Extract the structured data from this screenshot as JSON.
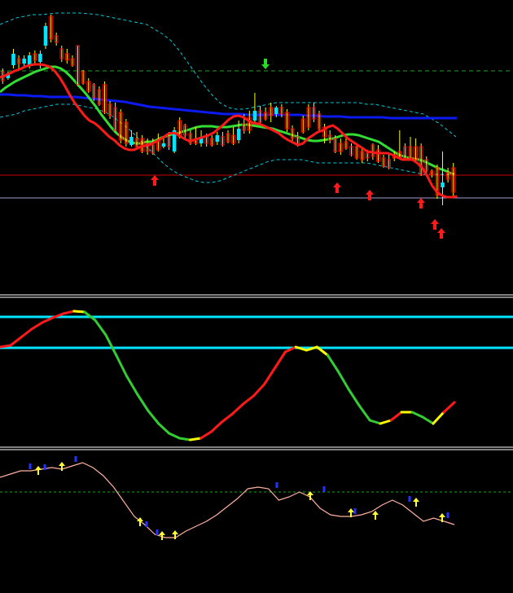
{
  "colors": {
    "background": "#000000",
    "bull_candle": "#00E5FF",
    "bear_candle": "#FF0000",
    "wick": "#FFFF00",
    "ma_fast": "#FF1A1A",
    "ma_mid": "#33DD33",
    "ma_slow": "#0A1AF0",
    "bands": "#00C8D8",
    "panel_sep": "#FFFFFF",
    "level_line": "#00E5FF",
    "osc_up": "#33CC33",
    "osc_down": "#FF1A1A",
    "osc_turn": "#FFFF00",
    "arrow_up": "#FF1A1A",
    "arrow_down": "#22DD22",
    "hline_red": "#CC0000",
    "hline_grey": "#9AA0C8",
    "hline_green_dash": "#1FA01F",
    "lower_line": "#FFB0A0",
    "lower_dash": "#1FA01F",
    "lower_up_arrow": "#FFFF33",
    "lower_down_mark": "#2233FF"
  },
  "chart_data": [
    {
      "type": "line",
      "panel": "price",
      "candles": [
        {
          "o": 88,
          "c": 99,
          "h": 84,
          "l": 103
        },
        {
          "o": 96,
          "c": 90,
          "h": 88,
          "l": 98
        },
        {
          "o": 80,
          "c": 66,
          "h": 60,
          "l": 84
        },
        {
          "o": 72,
          "c": 78,
          "h": 68,
          "l": 84
        },
        {
          "o": 78,
          "c": 72,
          "h": 68,
          "l": 82
        },
        {
          "o": 80,
          "c": 68,
          "h": 64,
          "l": 84
        },
        {
          "o": 66,
          "c": 74,
          "h": 62,
          "l": 80
        },
        {
          "o": 76,
          "c": 66,
          "h": 62,
          "l": 84
        },
        {
          "o": 56,
          "c": 32,
          "h": 28,
          "l": 60
        },
        {
          "o": 20,
          "c": 48,
          "h": 18,
          "l": 52
        },
        {
          "o": 44,
          "c": 52,
          "h": 40,
          "l": 56
        },
        {
          "o": 60,
          "c": 72,
          "h": 56,
          "l": 76
        },
        {
          "o": 66,
          "c": 74,
          "h": 60,
          "l": 78
        },
        {
          "o": 72,
          "c": 80,
          "h": 68,
          "l": 82
        },
        {
          "o": 56,
          "c": 104,
          "h": 56,
          "l": 106
        },
        {
          "o": 88,
          "c": 102,
          "h": 86,
          "l": 104
        },
        {
          "o": 100,
          "c": 112,
          "h": 96,
          "l": 114
        },
        {
          "o": 104,
          "c": 120,
          "h": 102,
          "l": 124
        },
        {
          "o": 110,
          "c": 128,
          "h": 106,
          "l": 130
        },
        {
          "o": 104,
          "c": 138,
          "h": 100,
          "l": 140
        },
        {
          "o": 128,
          "c": 142,
          "h": 124,
          "l": 146
        },
        {
          "o": 132,
          "c": 160,
          "h": 126,
          "l": 162
        },
        {
          "o": 138,
          "c": 172,
          "h": 134,
          "l": 176
        },
        {
          "o": 150,
          "c": 176,
          "h": 146,
          "l": 180
        },
        {
          "o": 178,
          "c": 168,
          "h": 160,
          "l": 180
        },
        {
          "o": 170,
          "c": 180,
          "h": 162,
          "l": 184
        },
        {
          "o": 170,
          "c": 186,
          "h": 166,
          "l": 188
        },
        {
          "o": 176,
          "c": 186,
          "h": 170,
          "l": 190
        },
        {
          "o": 178,
          "c": 188,
          "h": 170,
          "l": 190
        },
        {
          "o": 172,
          "c": 184,
          "h": 164,
          "l": 186
        },
        {
          "o": 180,
          "c": 176,
          "h": 168,
          "l": 182
        },
        {
          "o": 168,
          "c": 180,
          "h": 162,
          "l": 184
        },
        {
          "o": 186,
          "c": 160,
          "h": 156,
          "l": 188
        },
        {
          "o": 148,
          "c": 168,
          "h": 144,
          "l": 170
        },
        {
          "o": 154,
          "c": 166,
          "h": 152,
          "l": 170
        },
        {
          "o": 164,
          "c": 176,
          "h": 160,
          "l": 178
        },
        {
          "o": 170,
          "c": 176,
          "h": 156,
          "l": 178
        },
        {
          "o": 176,
          "c": 168,
          "h": 160,
          "l": 180
        },
        {
          "o": 168,
          "c": 176,
          "h": 164,
          "l": 180
        },
        {
          "o": 170,
          "c": 178,
          "h": 166,
          "l": 180
        },
        {
          "o": 174,
          "c": 166,
          "h": 162,
          "l": 178
        },
        {
          "o": 168,
          "c": 178,
          "h": 162,
          "l": 180
        },
        {
          "o": 164,
          "c": 174,
          "h": 160,
          "l": 176
        },
        {
          "o": 166,
          "c": 176,
          "h": 156,
          "l": 178
        },
        {
          "o": 172,
          "c": 158,
          "h": 148,
          "l": 176
        },
        {
          "o": 152,
          "c": 160,
          "h": 140,
          "l": 164
        },
        {
          "o": 144,
          "c": 160,
          "h": 136,
          "l": 164
        },
        {
          "o": 148,
          "c": 136,
          "h": 114,
          "l": 152
        },
        {
          "o": 136,
          "c": 150,
          "h": 130,
          "l": 154
        },
        {
          "o": 138,
          "c": 146,
          "h": 132,
          "l": 148
        },
        {
          "o": 132,
          "c": 142,
          "h": 126,
          "l": 150
        },
        {
          "o": 140,
          "c": 132,
          "h": 130,
          "l": 144
        },
        {
          "o": 132,
          "c": 140,
          "h": 128,
          "l": 144
        },
        {
          "o": 138,
          "c": 158,
          "h": 134,
          "l": 162
        },
        {
          "o": 158,
          "c": 170,
          "h": 154,
          "l": 176
        },
        {
          "o": 168,
          "c": 178,
          "h": 162,
          "l": 180
        },
        {
          "o": 146,
          "c": 162,
          "h": 142,
          "l": 164
        },
        {
          "o": 132,
          "c": 156,
          "h": 128,
          "l": 160
        },
        {
          "o": 132,
          "c": 146,
          "h": 126,
          "l": 150
        },
        {
          "o": 140,
          "c": 158,
          "h": 136,
          "l": 160
        },
        {
          "o": 156,
          "c": 168,
          "h": 152,
          "l": 176
        },
        {
          "o": 166,
          "c": 172,
          "h": 160,
          "l": 176
        },
        {
          "o": 170,
          "c": 186,
          "h": 166,
          "l": 188
        },
        {
          "o": 176,
          "c": 186,
          "h": 170,
          "l": 190
        },
        {
          "o": 174,
          "c": 182,
          "h": 170,
          "l": 184
        },
        {
          "o": 180,
          "c": 190,
          "h": 176,
          "l": 192
        },
        {
          "o": 180,
          "c": 194,
          "h": 176,
          "l": 196
        },
        {
          "o": 186,
          "c": 196,
          "h": 182,
          "l": 200
        },
        {
          "o": 188,
          "c": 194,
          "h": 184,
          "l": 198
        },
        {
          "o": 178,
          "c": 192,
          "h": 176,
          "l": 196
        },
        {
          "o": 184,
          "c": 198,
          "h": 178,
          "l": 200
        },
        {
          "o": 194,
          "c": 204,
          "h": 190,
          "l": 206
        },
        {
          "o": 196,
          "c": 206,
          "h": 190,
          "l": 208
        },
        {
          "o": 190,
          "c": 194,
          "h": 186,
          "l": 198
        },
        {
          "o": 186,
          "c": 194,
          "h": 160,
          "l": 196
        },
        {
          "o": 180,
          "c": 194,
          "h": 176,
          "l": 196
        },
        {
          "o": 180,
          "c": 194,
          "h": 168,
          "l": 196
        },
        {
          "o": 180,
          "c": 196,
          "h": 170,
          "l": 198
        },
        {
          "o": 180,
          "c": 214,
          "h": 176,
          "l": 216
        },
        {
          "o": 196,
          "c": 210,
          "h": 192,
          "l": 214
        },
        {
          "o": 210,
          "c": 214,
          "h": 208,
          "l": 218
        },
        {
          "o": 206,
          "c": 240,
          "h": 202,
          "l": 244
        },
        {
          "o": 230,
          "c": 224,
          "h": 186,
          "l": 252
        },
        {
          "o": 212,
          "c": 220,
          "h": 206,
          "l": 224
        },
        {
          "o": 206,
          "c": 236,
          "h": 200,
          "l": 242
        }
      ],
      "series": [
        {
          "name": "",
          "values": [
            95,
            93,
            90,
            87,
            85,
            82,
            80,
            79,
            79,
            80,
            82,
            87,
            95,
            105,
            116,
            126,
            134,
            142,
            148,
            151,
            156,
            162,
            168,
            172,
            178,
            182,
            184,
            184,
            181,
            179,
            178,
            175,
            172,
            168,
            164,
            163,
            166,
            170,
            173,
            172,
            170,
            168,
            166,
            163,
            158,
            153,
            147,
            143,
            142,
            144,
            148,
            151,
            152,
            154,
            157,
            160,
            163,
            168,
            172,
            175,
            178,
            176,
            170,
            166,
            162,
            160,
            156,
            154,
            158,
            164,
            170,
            174,
            178,
            182,
            186,
            187,
            188,
            188,
            188,
            190,
            193,
            196,
            196,
            196,
            200,
            206,
            216,
            228,
            236,
            240,
            242,
            242,
            241
          ]
        },
        {
          "name": "",
          "values": [
            113,
            108,
            104,
            100,
            97,
            94,
            91,
            88,
            86,
            84,
            82,
            82,
            84,
            88,
            94,
            101,
            108,
            115,
            123,
            131,
            140,
            148,
            156,
            163,
            168,
            172,
            175,
            176,
            176,
            174,
            174,
            172,
            169,
            167,
            165,
            164,
            162,
            160,
            158,
            156,
            155,
            155,
            155,
            156,
            156,
            156,
            155,
            154,
            153,
            153,
            154,
            155,
            156,
            157,
            158,
            160,
            162,
            164,
            166,
            168,
            170,
            172,
            173,
            173,
            172,
            171,
            170,
            168,
            166,
            165,
            165,
            166,
            168,
            170,
            172,
            174,
            178,
            182,
            186,
            190,
            192,
            194,
            195,
            196,
            198,
            201,
            204,
            207,
            209,
            212,
            214
          ]
        },
        {
          "name": "",
          "values": [
            116,
            116,
            117,
            117,
            118,
            118,
            119,
            119,
            119,
            119,
            120,
            121,
            122,
            123,
            124,
            125,
            127,
            129,
            131,
            132,
            133,
            134,
            135,
            136,
            137,
            138,
            139,
            140,
            140,
            140,
            141,
            141,
            141,
            141,
            141,
            141,
            141,
            142,
            142,
            143,
            143,
            143,
            144,
            144,
            144,
            144,
            144,
            145,
            145,
            145,
            145,
            145,
            145,
            145,
            145,
            145
          ]
        }
      ],
      "bands": {
        "upper": [
          30,
          26,
          22,
          20,
          18,
          18,
          17,
          16,
          16,
          16,
          16,
          17,
          18,
          20,
          22,
          24,
          26,
          28,
          30,
          36,
          42,
          50,
          62,
          76,
          90,
          104,
          116,
          126,
          132,
          134,
          134,
          132,
          130,
          128,
          126,
          126,
          126,
          126,
          126,
          126,
          126,
          126,
          126,
          126,
          126,
          128,
          128,
          130,
          132,
          134,
          136,
          138,
          140,
          146,
          152,
          160,
          168
        ],
        "lower": [
          144,
          142,
          140,
          136,
          134,
          132,
          130,
          128,
          128,
          128,
          130,
          132,
          134,
          138,
          144,
          152,
          160,
          170,
          180,
          190,
          200,
          208,
          214,
          218,
          222,
          224,
          224,
          222,
          218,
          214,
          210,
          206,
          202,
          198,
          196,
          196,
          196,
          196,
          198,
          200,
          200,
          200,
          200,
          200,
          200,
          200,
          202,
          204,
          206,
          208,
          210,
          212,
          214,
          214,
          214,
          214,
          214
        ]
      },
      "hlines": [
        87,
        215,
        243
      ],
      "arrows_up": [
        [
          190,
          222
        ],
        [
          414,
          231
        ],
        [
          454,
          240
        ],
        [
          517,
          250
        ],
        [
          534,
          276
        ],
        [
          542,
          287
        ]
      ],
      "arrows_down": [
        [
          326,
          78
        ]
      ]
    },
    {
      "type": "line",
      "panel": "oscillator",
      "levels": [
        389,
        427
      ],
      "values": [
        426,
        424,
        414,
        404,
        396,
        390,
        385,
        382,
        383,
        393,
        411,
        436,
        462,
        484,
        504,
        520,
        532,
        538,
        540,
        538,
        530,
        518,
        508,
        496,
        486,
        472,
        452,
        432,
        426,
        430,
        426,
        436,
        456,
        478,
        498,
        516,
        520,
        516,
        506,
        506,
        512,
        520,
        506,
        494
      ]
    },
    {
      "type": "line",
      "panel": "lower",
      "values": [
        586,
        582,
        578,
        578,
        576,
        574,
        576,
        572,
        568,
        574,
        584,
        598,
        616,
        634,
        644,
        656,
        660,
        660,
        652,
        646,
        640,
        632,
        622,
        612,
        600,
        598,
        600,
        614,
        610,
        604,
        610,
        624,
        632,
        634,
        634,
        632,
        628,
        620,
        614,
        620,
        630,
        640,
        636,
        640,
        644
      ],
      "dash_level": 604,
      "marks_up": [
        [
          47,
          578
        ],
        [
          76,
          573
        ],
        [
          172,
          641
        ],
        [
          199,
          658
        ],
        [
          215,
          657
        ],
        [
          381,
          609
        ],
        [
          431,
          630
        ],
        [
          461,
          633
        ],
        [
          511,
          617
        ],
        [
          543,
          636
        ]
      ],
      "marks_down": [
        [
          37,
          574
        ],
        [
          55,
          575
        ],
        [
          93,
          565
        ],
        [
          180,
          645
        ],
        [
          193,
          655
        ],
        [
          340,
          597
        ],
        [
          398,
          602
        ],
        [
          436,
          629
        ],
        [
          503,
          614
        ],
        [
          550,
          634
        ]
      ]
    }
  ]
}
